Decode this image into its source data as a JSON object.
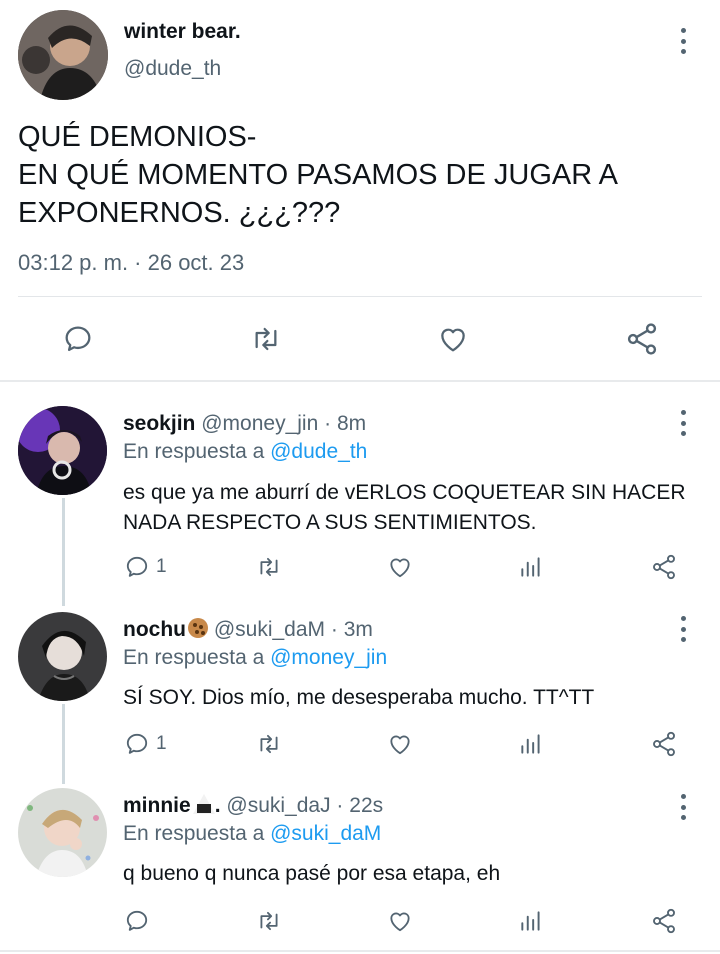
{
  "main_tweet": {
    "display_name": "winter bear.",
    "handle": "@dude_th",
    "text_lines": [
      "QUÉ DEMONIOS-",
      "EN QUÉ MOMENTO PASAMOS DE JUGAR A",
      "EXPONERNOS. ¿¿¿???"
    ],
    "timestamp": "03:12 p. m. · 26 oct. 23",
    "icons": [
      "reply-icon",
      "retweet-icon",
      "like-icon",
      "share-icon",
      "more-icon"
    ]
  },
  "replies": [
    {
      "display_name": "seokjin",
      "handle": "@money_jin",
      "time": "8m",
      "in_reply_prefix": "En respuesta a",
      "in_reply_to": "@dude_th",
      "text": "es que ya me aburrí de vERLOS COQUETEAR SIN HACER NADA RESPECTO A SUS SENTIMIENTOS.",
      "reply_count": "1"
    },
    {
      "display_name": "nochu",
      "name_emoji": "cookie",
      "handle": "@suki_daM",
      "time": "3m",
      "in_reply_prefix": "En respuesta a",
      "in_reply_to": "@money_jin",
      "text": "SÍ SOY. Dios mío, me desesperaba mucho. TT^TT",
      "reply_count": "1"
    },
    {
      "display_name": "minnie",
      "name_emoji": "onigiri",
      "name_suffix": ".",
      "handle": "@suki_daJ",
      "time": "22s",
      "in_reply_prefix": "En respuesta a",
      "in_reply_to": "@suki_daM",
      "text": "q bueno q nunca pasé por esa etapa, eh",
      "reply_count": ""
    }
  ],
  "colors": {
    "text": "#0f1419",
    "secondary": "#536471",
    "link": "#1d9bf0",
    "divider": "#e3e6e9"
  }
}
